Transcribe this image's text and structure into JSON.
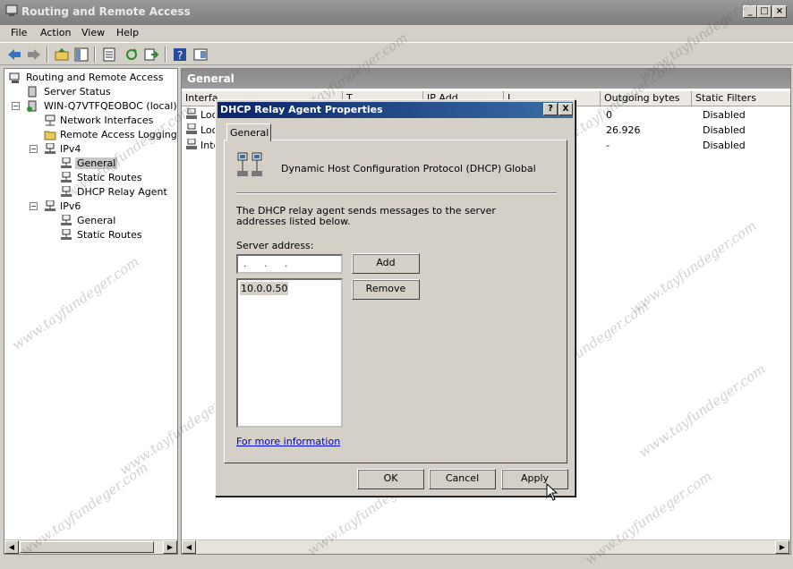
{
  "window": {
    "title": "Routing and Remote Access"
  },
  "menu": [
    "File",
    "Action",
    "View",
    "Help"
  ],
  "tree": {
    "root": "Routing and Remote Access",
    "server_status": "Server Status",
    "server": "WIN-Q7VTFQEOBOC (local)",
    "network_interfaces": "Network Interfaces",
    "remote_access_logging": "Remote Access Logging & P",
    "ipv4": "IPv4",
    "ipv4_general": "General",
    "ipv4_static_routes": "Static Routes",
    "ipv4_dhcp_relay": "DHCP Relay Agent",
    "ipv6": "IPv6",
    "ipv6_general": "General",
    "ipv6_static_routes": "Static Routes"
  },
  "right_pane": {
    "header": "General",
    "columns": [
      "Interfa",
      "T",
      "IP Add",
      "I",
      "Outgoing bytes",
      "Static Filters"
    ],
    "rows": [
      {
        "name": "Loc",
        "outgoing": "0",
        "filters": "Disabled"
      },
      {
        "name": "Loc",
        "outgoing": "26.926",
        "filters": "Disabled"
      },
      {
        "name": "Inte",
        "outgoing": "-",
        "filters": "Disabled"
      }
    ]
  },
  "dialog": {
    "title": "DHCP Relay Agent Properties",
    "help_btn": "?",
    "close_btn": "X",
    "tab": "General",
    "heading": "Dynamic Host Configuration Protocol (DHCP) Global",
    "description": "The DHCP relay agent sends messages to the server addresses listed below.",
    "server_label": "Server address:",
    "ip_placeholder": ". . .",
    "add": "Add",
    "remove": "Remove",
    "servers": [
      "10.0.0.50"
    ],
    "more_info": "For more information",
    "ok": "OK",
    "cancel": "Cancel",
    "apply": "Apply"
  },
  "watermark": "www.tayfundeger.com"
}
